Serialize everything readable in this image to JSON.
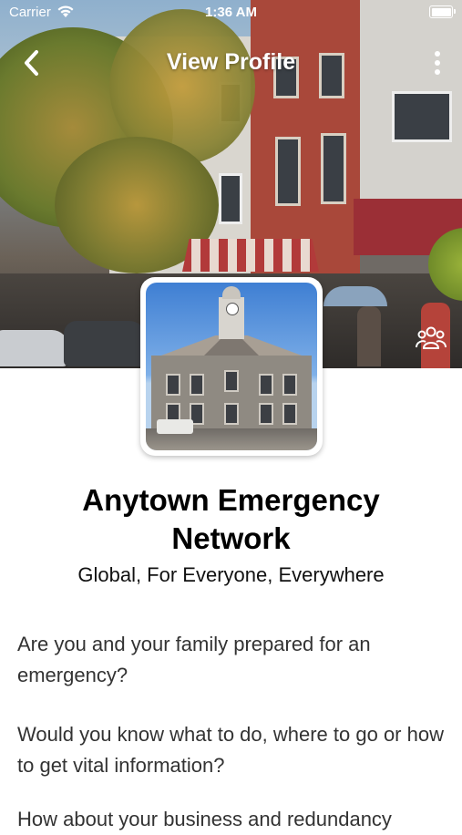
{
  "status_bar": {
    "carrier": "Carrier",
    "time": "1:36 AM"
  },
  "nav": {
    "title": "View Profile",
    "back_icon": "chevron-left-icon",
    "more_icon": "vertical-ellipsis-icon"
  },
  "profile": {
    "name_line1": "Anytown Emergency",
    "name_line2": "Network",
    "tagline": "Global, For Everyone, Everywhere",
    "members_icon": "group-icon",
    "description": [
      "Are you and your family prepared for an emergency?",
      "Would you know what to do, where to go or how to get vital information?",
      "How about your business and redundancy"
    ]
  },
  "colors": {
    "nav_text": "#ffffff",
    "body_text": "#333333",
    "title_text": "#000000"
  }
}
